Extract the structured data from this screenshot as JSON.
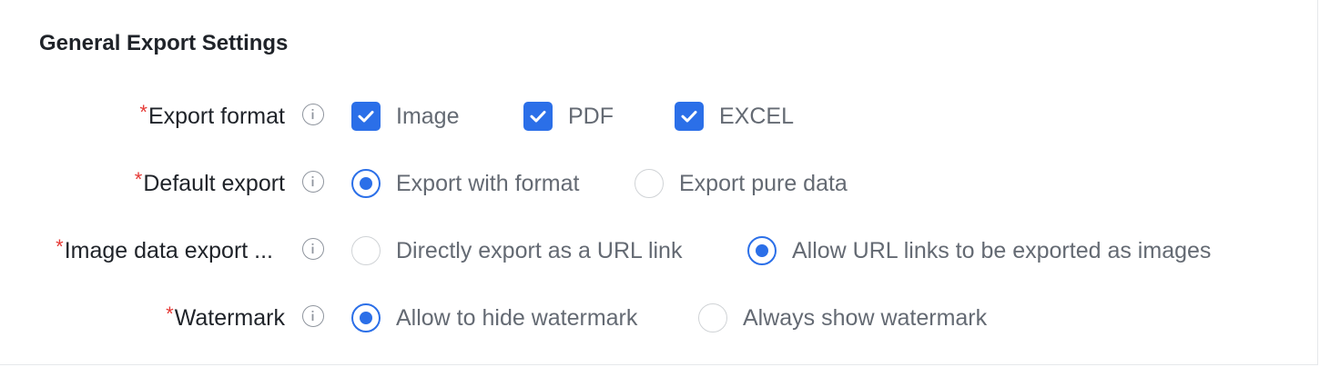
{
  "section": {
    "title": "General Export Settings"
  },
  "colors": {
    "accent": "#2b6fe8",
    "required": "#e53935",
    "label": "#1f2329",
    "option_text": "#646a73"
  },
  "rows": [
    {
      "required_mark": "*",
      "label": "Export format",
      "info_icon": "info-icon",
      "control": "checkbox",
      "options": [
        {
          "label": "Image",
          "checked": true
        },
        {
          "label": "PDF",
          "checked": true
        },
        {
          "label": "EXCEL",
          "checked": true
        }
      ]
    },
    {
      "required_mark": "*",
      "label": "Default export",
      "info_icon": "info-icon",
      "control": "radio",
      "options": [
        {
          "label": "Export with format",
          "checked": true
        },
        {
          "label": "Export pure data",
          "checked": false
        }
      ]
    },
    {
      "required_mark": "*",
      "label": "Image data export ...",
      "info_icon": "info-icon",
      "control": "radio",
      "options": [
        {
          "label": "Directly export as a URL link",
          "checked": false
        },
        {
          "label": "Allow URL links to be exported as images",
          "checked": true
        }
      ]
    },
    {
      "required_mark": "*",
      "label": "Watermark",
      "info_icon": "info-icon",
      "control": "radio",
      "options": [
        {
          "label": "Allow to hide watermark",
          "checked": true
        },
        {
          "label": "Always show watermark",
          "checked": false
        }
      ]
    }
  ]
}
